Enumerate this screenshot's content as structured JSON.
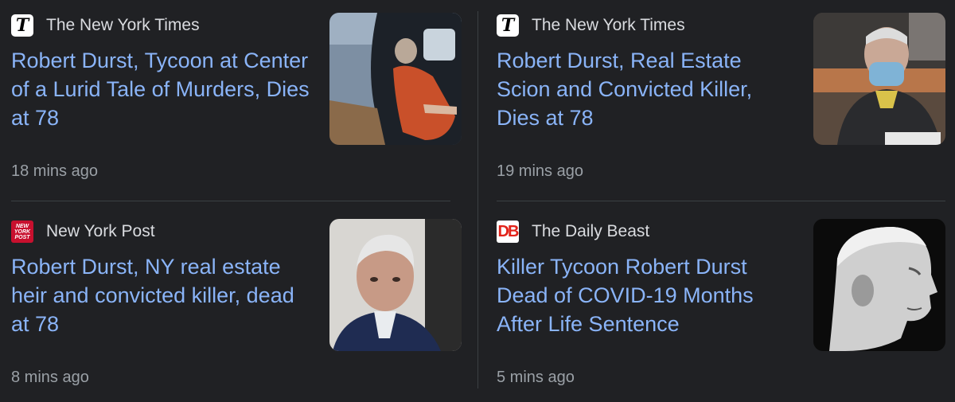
{
  "articles": [
    {
      "source": "The New York Times",
      "logo_icon": "nyt-logo-icon",
      "logo_text": "T",
      "headline": "Robert Durst, Tycoon at Center of a Lurid Tale of Murders, Dies at 78",
      "time": "18 mins ago",
      "thumbnail": "durst-in-car-thumbnail"
    },
    {
      "source": "The New York Times",
      "logo_icon": "nyt-logo-icon",
      "logo_text": "T",
      "headline": "Robert Durst, Real Estate Scion and Convicted Killer, Dies at 78",
      "time": "19 mins ago",
      "thumbnail": "durst-masked-in-court-thumbnail"
    },
    {
      "source": "New York Post",
      "logo_icon": "nypost-logo-icon",
      "logo_text": "NEW YORK POST",
      "headline": "Robert Durst, NY real estate heir and convicted killer, dead at 78",
      "time": "8 mins ago",
      "thumbnail": "durst-portrait-thumbnail"
    },
    {
      "source": "The Daily Beast",
      "logo_icon": "dailybeast-logo-icon",
      "logo_text": "DB",
      "headline": "Killer Tycoon Robert Durst Dead of COVID-19 Months After Life Sentence",
      "time": "5 mins ago",
      "thumbnail": "durst-profile-illustration-thumbnail"
    }
  ],
  "colors": {
    "background": "#202124",
    "headline": "#8ab4f8",
    "source": "#dadce0",
    "time": "#9aa0a6",
    "divider": "#3c4043"
  }
}
